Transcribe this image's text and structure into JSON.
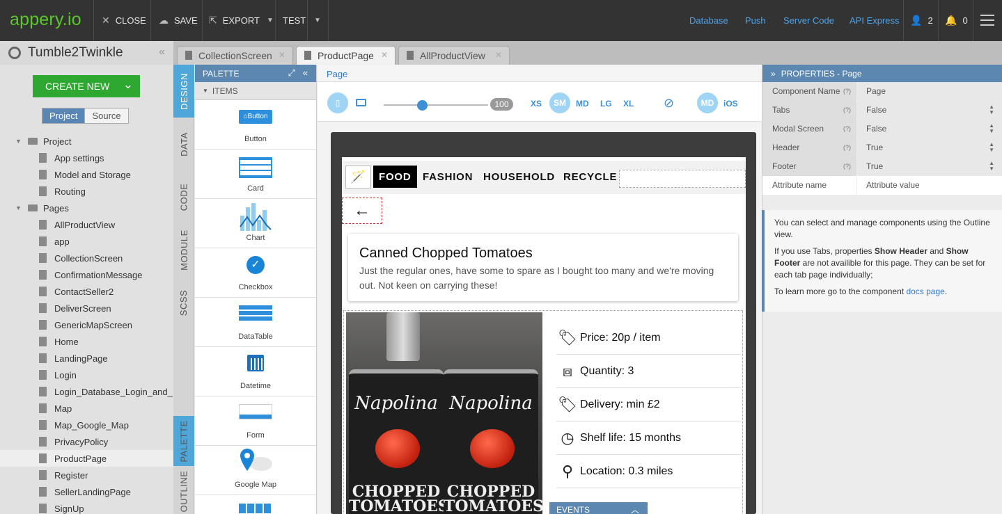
{
  "app": {
    "logo": "appery",
    "logo_suffix": ".io"
  },
  "topbar": {
    "close": "CLOSE",
    "save": "SAVE",
    "export": "EXPORT",
    "test": "TEST",
    "links": [
      "Database",
      "Push",
      "Server Code",
      "API Express"
    ],
    "users_count": "2",
    "notif_count": "0"
  },
  "project": {
    "name": "Tumble2Twinkle",
    "create_new": "CREATE NEW",
    "seg_project": "Project",
    "seg_source": "Source"
  },
  "file_tabs": [
    "CollectionScreen",
    "ProductPage",
    "AllProductView"
  ],
  "tree": {
    "project_folder": "Project",
    "project_items": [
      "App settings",
      "Model and Storage",
      "Routing"
    ],
    "pages_folder": "Pages",
    "pages": [
      "AllProductView",
      "app",
      "CollectionScreen",
      "ConfirmationMessage",
      "ContactSeller2",
      "DeliverScreen",
      "GenericMapScreen",
      "Home",
      "LandingPage",
      "Login",
      "Login_Database_Login_and_...",
      "Map",
      "Map_Google_Map",
      "PrivacyPolicy",
      "ProductPage",
      "Register",
      "SellerLandingPage",
      "SignUp"
    ],
    "selected": "ProductPage"
  },
  "vtabs": [
    "DESIGN",
    "DATA",
    "CODE",
    "MODULE",
    "SCSS",
    "PALETTE",
    "OUTLINE"
  ],
  "palette": {
    "title": "PALETTE",
    "section": "ITEMS",
    "items": [
      "Button",
      "Card",
      "Chart",
      "Checkbox",
      "DataTable",
      "Datetime",
      "Form",
      "Google Map"
    ],
    "button_preview": "Button"
  },
  "canvas": {
    "breadcrumb": "Page",
    "zoom": "100",
    "breakpoints": [
      "XS",
      "SM",
      "MD",
      "LG",
      "XL"
    ],
    "active_breakpoint": "SM",
    "mode_md": "MD",
    "mode_ios": "iOS"
  },
  "screen": {
    "categories": [
      "FOOD",
      "FASHION",
      "HOUSEHOLD",
      "RECYCLE"
    ],
    "active_category": "FOOD",
    "back_arrow": "←",
    "product_title": "Canned Chopped Tomatoes",
    "product_desc": "Just the regular ones, have some to spare as I bought too many and we're moving out. Not keen on carrying these!",
    "can_brand": "Napolina",
    "can_label": "CHOPPED TOMATOES",
    "info": [
      {
        "icon": "price-tag-icon",
        "text": "Price: 20p / item"
      },
      {
        "icon": "boxes-icon",
        "text": "Quantity: 3"
      },
      {
        "icon": "delivery-tag-icon",
        "text": "Delivery: min £2"
      },
      {
        "icon": "clock-icon",
        "text": "Shelf life: 15 months"
      },
      {
        "icon": "location-pin-icon",
        "text": "Location: 0.3 miles"
      }
    ],
    "events": "EVENTS"
  },
  "properties": {
    "title": "PROPERTIES - Page",
    "rows": [
      {
        "key": "Component Name",
        "value": "Page"
      },
      {
        "key": "Tabs",
        "value": "False"
      },
      {
        "key": "Modal Screen",
        "value": "False"
      },
      {
        "key": "Header",
        "value": "True"
      },
      {
        "key": "Footer",
        "value": "True"
      },
      {
        "key": "Attribute name",
        "value": "Attribute value"
      }
    ],
    "help_1": "You can select and manage components using the Outline view.",
    "help_2a": "If you use Tabs, properties ",
    "help_2b": "Show Header",
    "help_2c": " and ",
    "help_2d": "Show Footer",
    "help_2e": " are not availible for this page. They can be set for each tab page individually;",
    "help_3a": "To learn more go to the component ",
    "help_3b": "docs page",
    "help_3c": "."
  }
}
